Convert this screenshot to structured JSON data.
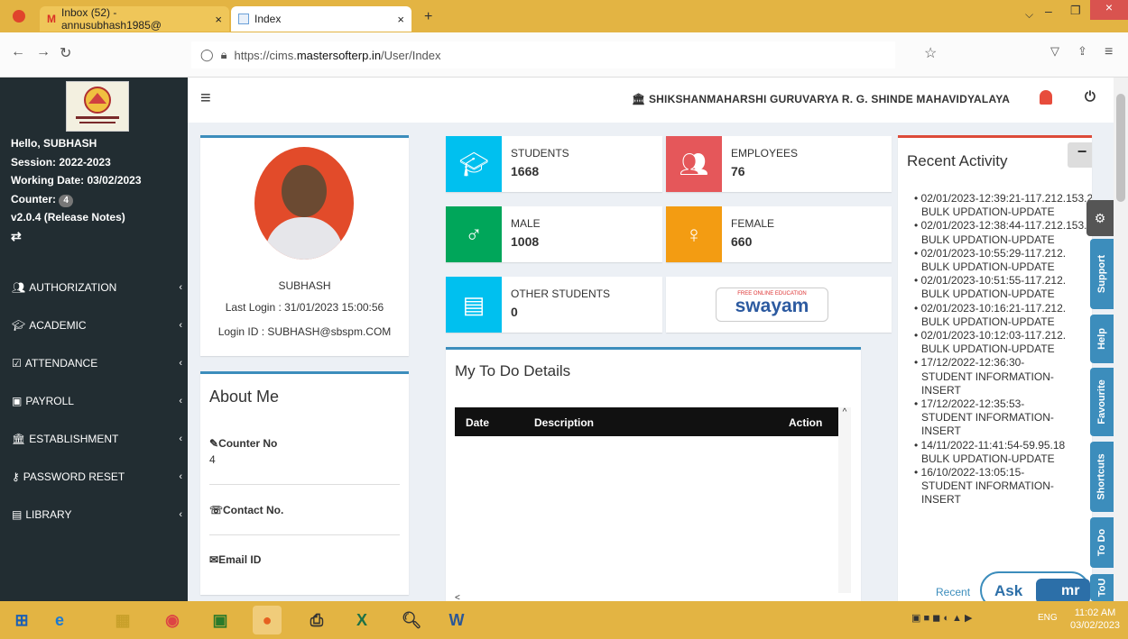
{
  "browser": {
    "tab1": "Inbox (52) - annusubhash1985@",
    "tab2": "Index",
    "url_prefix": "https://cims.",
    "url_domain": "mastersofterp.in",
    "url_path": "/User/Index"
  },
  "sidebar": {
    "greeting": "Hello, SUBHASH",
    "session": "Session: 2022-2023",
    "working_date": "Working Date: 03/02/2023",
    "counter_label": "Counter:",
    "counter_value": "4",
    "version": "v2.0.4 (Release Notes)",
    "items": [
      {
        "label": "AUTHORIZATION",
        "icon": "users-icon"
      },
      {
        "label": "ACADEMIC",
        "icon": "graduation-cap-icon"
      },
      {
        "label": "ATTENDANCE",
        "icon": "check-square-icon"
      },
      {
        "label": "PAYROLL",
        "icon": "money-icon"
      },
      {
        "label": "ESTABLISHMENT",
        "icon": "institution-icon"
      },
      {
        "label": "PASSWORD RESET",
        "icon": "key-icon"
      },
      {
        "label": "LIBRARY",
        "icon": "book-icon"
      }
    ]
  },
  "header": {
    "institution": "SHIKSHANMAHARSHI GURUVARYA R. G. SHINDE MAHAVIDYALAYA"
  },
  "profile": {
    "name": "SUBHASH",
    "last_login": "Last Login : 31/01/2023 15:00:56",
    "login_id": "Login ID : SUBHASH@sbspm.COM"
  },
  "about": {
    "title": "About Me",
    "counter_label": "Counter No",
    "counter_value": "4",
    "contact_label": "Contact No.",
    "email_label": "Email ID"
  },
  "stats": {
    "students_label": "STUDENTS",
    "students": "1668",
    "employees_label": "EMPLOYEES",
    "employees": "76",
    "male_label": "MALE",
    "male": "1008",
    "female_label": "FEMALE",
    "female": "660",
    "other_label": "OTHER STUDENTS",
    "other": "0",
    "swayam_top": "FREE ONLINE EDUCATION",
    "swayam": "swayam"
  },
  "todo": {
    "title": "My To Do Details",
    "col_date": "Date",
    "col_desc": "Description",
    "col_action": "Action"
  },
  "activity": {
    "title": "Recent Activity",
    "collapse": "−",
    "footer": "Recent",
    "items": [
      "02/01/2023-12:39:21-117.212.153.2",
      "BULK UPDATION-UPDATE",
      "02/01/2023-12:38:44-117.212.153.2",
      "BULK UPDATION-UPDATE",
      "02/01/2023-10:55:29-117.212.",
      "BULK UPDATION-UPDATE",
      "02/01/2023-10:51:55-117.212.",
      "BULK UPDATION-UPDATE",
      "02/01/2023-10:16:21-117.212.",
      "BULK UPDATION-UPDATE",
      "02/01/2023-10:12:03-117.212.",
      "BULK UPDATION-UPDATE",
      "17/12/2022-12:36:30-",
      "STUDENT INFORMATION-",
      "INSERT",
      "17/12/2022-12:35:53-",
      "STUDENT INFORMATION-",
      "INSERT",
      "14/11/2022-11:41:54-59.95.18",
      "BULK UPDATION-UPDATE",
      "16/10/2022-13:05:15-",
      "STUDENT INFORMATION-",
      "INSERT"
    ]
  },
  "sidetabs": [
    "Support",
    "Help",
    "Favourite",
    "Shortcuts",
    "To Do",
    "ToU"
  ],
  "chat": {
    "ask": "Ask",
    "brand": "mr"
  },
  "taskbar": {
    "lang": "ENG",
    "time": "11:02 AM",
    "date": "03/02/2023"
  }
}
